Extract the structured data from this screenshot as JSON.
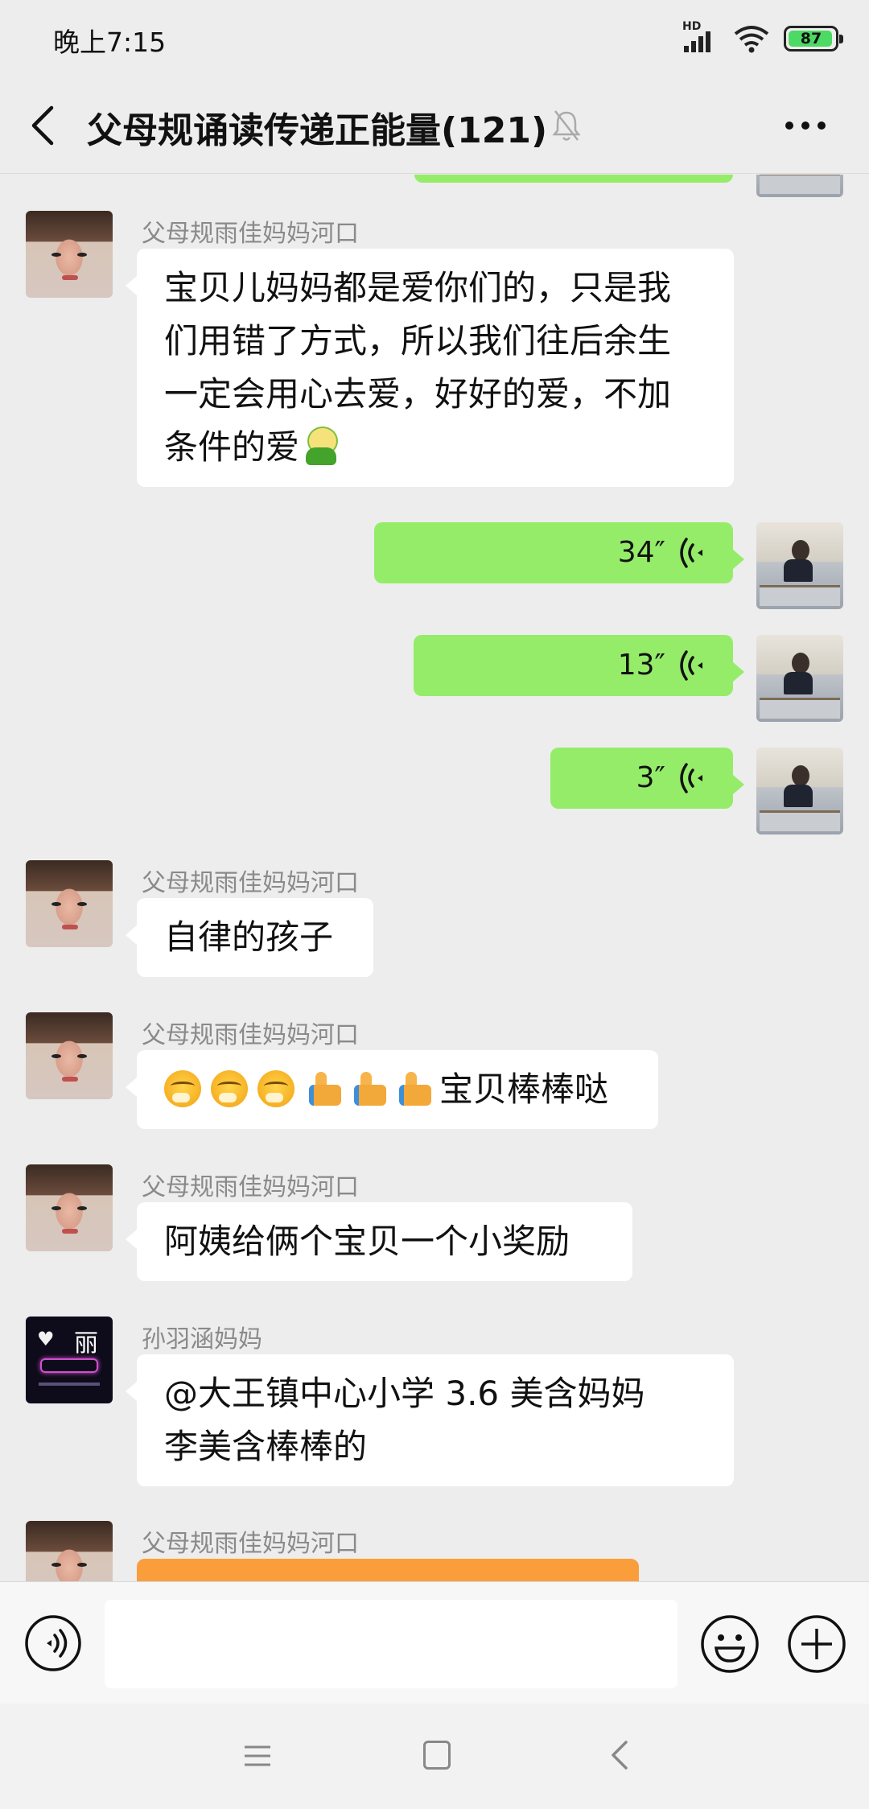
{
  "status": {
    "time": "晚上7:15",
    "signal_label": "HD",
    "battery": "87",
    "battery_level": 0.87
  },
  "header": {
    "title": "父母规诵读传递正能量(121)",
    "icons": [
      "back-icon",
      "mute-bell-icon",
      "more-icon"
    ]
  },
  "messages": [
    {
      "side": "left",
      "sender": "父母规雨佳妈妈河口",
      "lines": [
        "宝贝儿妈妈都是爱你们的，只是我",
        "们用错了方式，所以我们往后余生",
        "一定会用心去爱，好好的爱，不加",
        "条件的爱"
      ],
      "trailing_emoji": "pig-emoji"
    },
    {
      "side": "right",
      "type": "voice",
      "duration": "34″"
    },
    {
      "side": "right",
      "type": "voice",
      "duration": "13″"
    },
    {
      "side": "right",
      "type": "voice",
      "duration": "3″"
    },
    {
      "side": "left",
      "sender": "父母规雨佳妈妈河口",
      "text": "自律的孩子"
    },
    {
      "side": "left",
      "sender": "父母规雨佳妈妈河口",
      "emojis": [
        "hugging-face-emoji",
        "hugging-face-emoji",
        "hugging-face-emoji",
        "thumbs-up-emoji",
        "thumbs-up-emoji",
        "thumbs-up-emoji"
      ],
      "text": "宝贝棒棒哒"
    },
    {
      "side": "left",
      "sender": "父母规雨佳妈妈河口",
      "text": "阿姨给俩个宝贝一个小奖励"
    },
    {
      "side": "left",
      "sender": "孙羽涵妈妈",
      "lines": [
        "@大王镇中心小学 3.6 美含妈妈",
        "李美含棒棒的"
      ],
      "avatar_text": "丽"
    },
    {
      "side": "left",
      "sender": "父母规雨佳妈妈河口",
      "type": "red-packet"
    }
  ],
  "colors": {
    "background": "#ededed",
    "self_bubble": "#95ec69",
    "other_bubble": "#ffffff",
    "red_packet": "#fa9d3b"
  },
  "input": {
    "placeholder": "",
    "value": "",
    "icons": [
      "voice-input-icon",
      "emoji-icon",
      "plus-icon"
    ]
  },
  "nav": {
    "icons": [
      "menu-icon",
      "home-icon",
      "back-nav-icon"
    ]
  }
}
